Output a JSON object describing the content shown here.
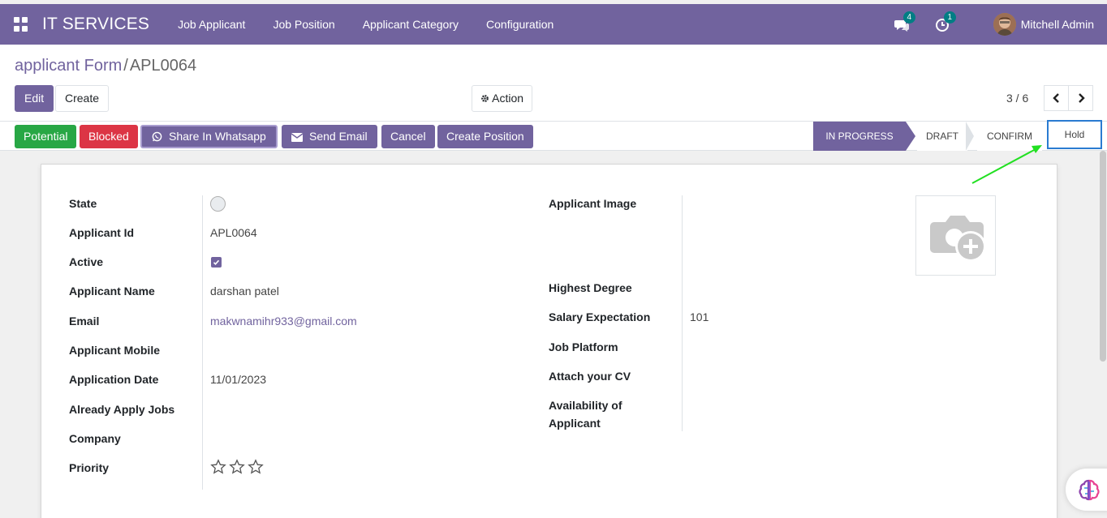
{
  "navbar": {
    "brand": "IT SERVICES",
    "menu": [
      "Job Applicant",
      "Job Position",
      "Applicant Category",
      "Configuration"
    ],
    "messages_count": "4",
    "activities_count": "1",
    "user_name": "Mitchell Admin",
    "color": "#71639e"
  },
  "breadcrumb": {
    "parent": "applicant Form",
    "separator": "/",
    "current": "APL0064"
  },
  "buttons": {
    "edit": "Edit",
    "create": "Create",
    "action": "Action"
  },
  "pager": {
    "value": "3 / 6"
  },
  "statusbar": {
    "potential": "Potential",
    "blocked": "Blocked",
    "whatsapp": "Share In Whatsapp",
    "send_email": "Send Email",
    "cancel": "Cancel",
    "create_position": "Create Position",
    "stages": [
      "IN PROGRESS",
      "DRAFT",
      "CONFIRM",
      "Hold"
    ],
    "active_stage": "IN PROGRESS"
  },
  "form": {
    "left": [
      {
        "label": "State",
        "value": ""
      },
      {
        "label": "Applicant Id",
        "value": "APL0064"
      },
      {
        "label": "Active",
        "value": "checked"
      },
      {
        "label": "Applicant Name",
        "value": "darshan patel"
      },
      {
        "label": "Email",
        "value": "makwnamihr933@gmail.com"
      },
      {
        "label": "Applicant Mobile",
        "value": ""
      },
      {
        "label": "Application Date",
        "value": "11/01/2023"
      },
      {
        "label": "Already Apply Jobs",
        "value": ""
      },
      {
        "label": "Company",
        "value": ""
      },
      {
        "label": "Priority",
        "value": "0 of 3 stars"
      }
    ],
    "right": [
      {
        "label": "Applicant Image",
        "value": ""
      },
      {
        "label": "Highest Degree",
        "value": ""
      },
      {
        "label": "Salary Expectation",
        "value": "101"
      },
      {
        "label": "Job Platform",
        "value": ""
      },
      {
        "label": "Attach your CV",
        "value": ""
      },
      {
        "label": "Availability of",
        "value": ""
      },
      {
        "label": "Applicant",
        "value": ""
      }
    ],
    "priority": 0
  }
}
